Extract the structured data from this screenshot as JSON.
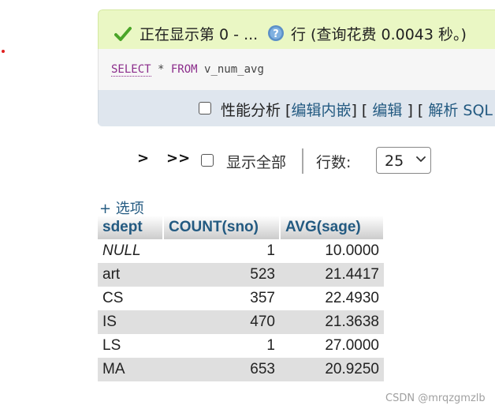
{
  "message": {
    "success_text": "正在显示第 0 - ...",
    "success_text2": "行 (查询花费 0.0043 秒。)",
    "sql_kw_select": "SELECT",
    "sql_star": " * ",
    "sql_kw_from": "FROM",
    "sql_view": " v_num_avg"
  },
  "actions": {
    "profiling": "性能分析",
    "open1": " [",
    "edit_inline": "编辑内嵌",
    "mid1": "] [ ",
    "edit": "编辑",
    "mid2": " ] [ ",
    "explain": "解析 SQL"
  },
  "nav": {
    "next": ">",
    "last": ">>",
    "show_all": "显示全部",
    "rows_label": "行数:",
    "rows_value": "25"
  },
  "options_link": "+ 选项",
  "table": {
    "columns": [
      "sdept",
      "COUNT(sno)",
      "AVG(sage)"
    ],
    "rows": [
      [
        "NULL",
        "1",
        "10.0000"
      ],
      [
        "art",
        "523",
        "21.4417"
      ],
      [
        "CS",
        "357",
        "22.4930"
      ],
      [
        "IS",
        "470",
        "21.3638"
      ],
      [
        "LS",
        "1",
        "27.0000"
      ],
      [
        "MA",
        "653",
        "20.9250"
      ]
    ]
  },
  "watermark": "CSDN @mrqzgmzlb",
  "colors": {
    "success_bg": "#eaf7c4",
    "query_bg": "#f6f6f6",
    "actions_bg": "#dfe6ee",
    "link": "#235a81",
    "sql_keyword": "#8b2c8b",
    "row_alt": "#dfdfdf"
  },
  "icons": {
    "success": "check-icon",
    "help": "help-icon",
    "dropdown": "chevron-down-icon"
  }
}
